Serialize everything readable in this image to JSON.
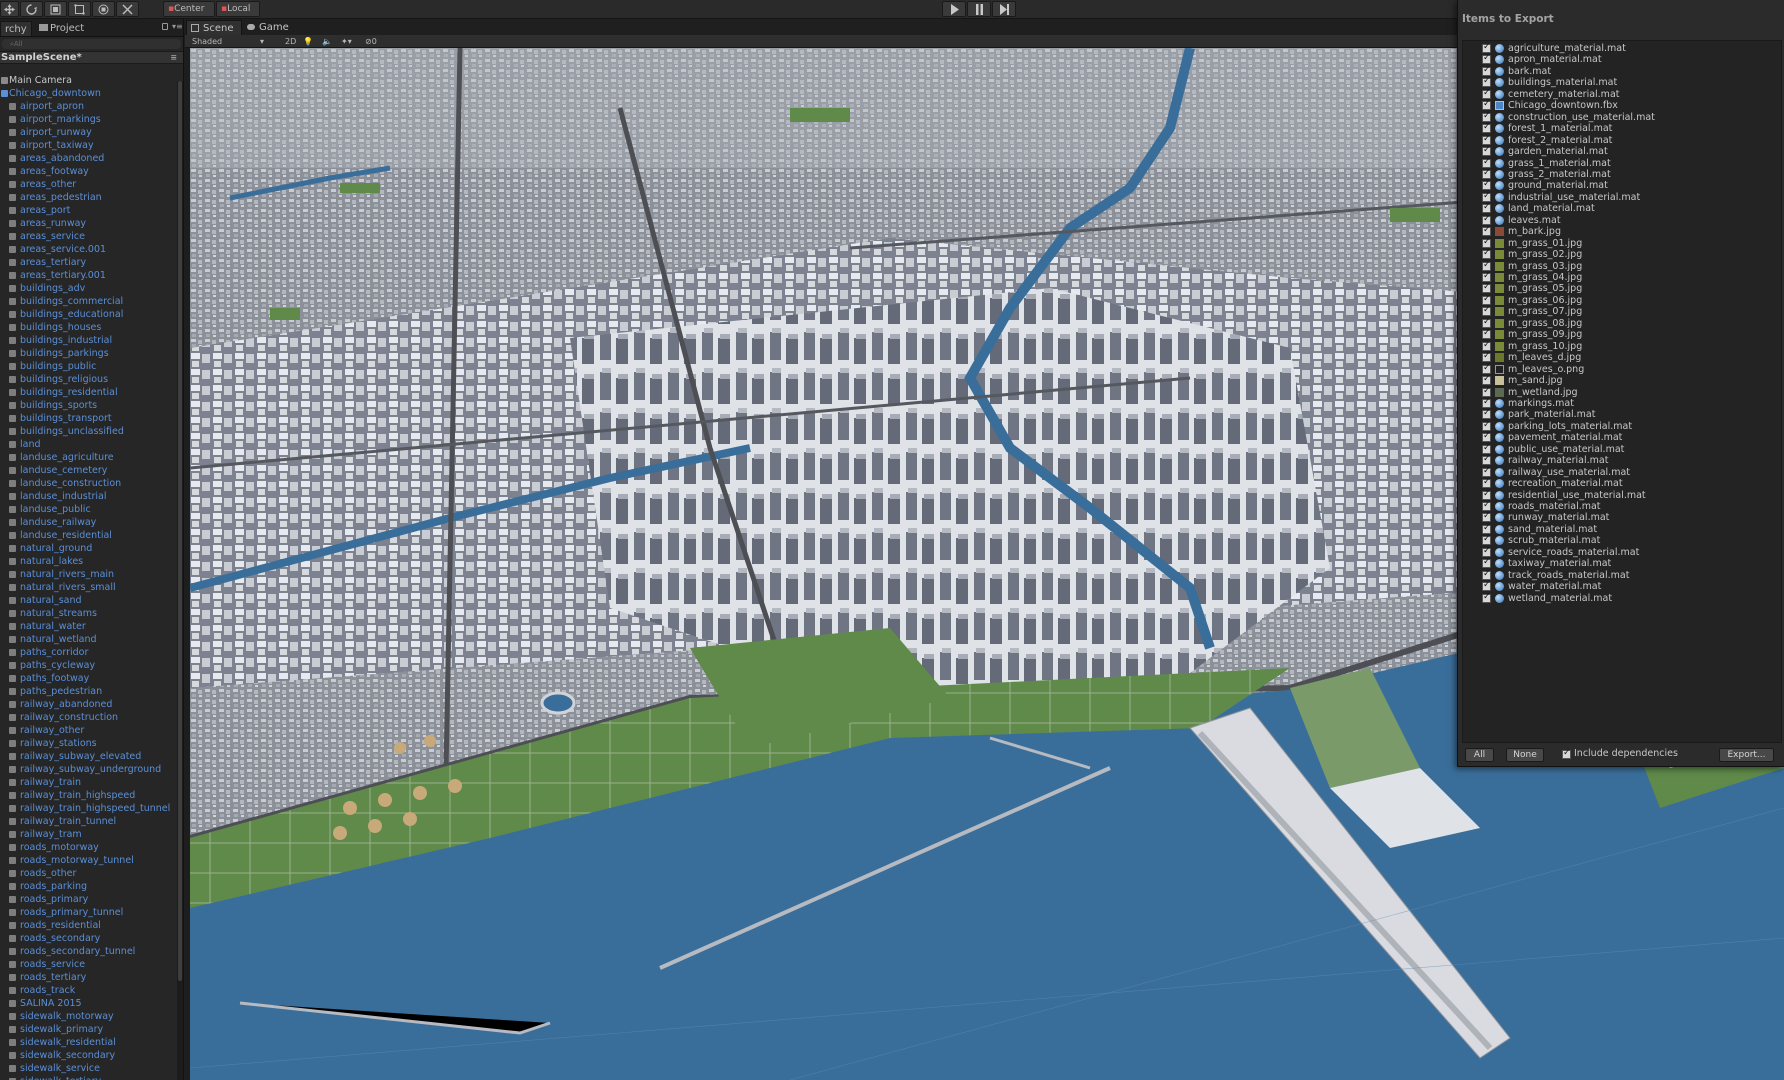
{
  "toolbar": {
    "pivot_label": "Center",
    "space_label": "Local"
  },
  "hierarchy": {
    "tab_label": "rchy",
    "project_tab_label": "Project",
    "search_placeholder": "All",
    "scene_name": "SampleScene*",
    "camera_label": "Main Camera",
    "root_label": "Chicago_downtown",
    "items": [
      "airport_apron",
      "airport_markings",
      "airport_runway",
      "airport_taxiway",
      "areas_abandoned",
      "areas_footway",
      "areas_other",
      "areas_pedestrian",
      "areas_port",
      "areas_runway",
      "areas_service",
      "areas_service.001",
      "areas_tertiary",
      "areas_tertiary.001",
      "buildings_adv",
      "buildings_commercial",
      "buildings_educational",
      "buildings_houses",
      "buildings_industrial",
      "buildings_parkings",
      "buildings_public",
      "buildings_religious",
      "buildings_residential",
      "buildings_sports",
      "buildings_transport",
      "buildings_unclassified",
      "land",
      "landuse_agriculture",
      "landuse_cemetery",
      "landuse_construction",
      "landuse_industrial",
      "landuse_public",
      "landuse_railway",
      "landuse_residential",
      "natural_ground",
      "natural_lakes",
      "natural_rivers_main",
      "natural_rivers_small",
      "natural_sand",
      "natural_streams",
      "natural_water",
      "natural_wetland",
      "paths_corridor",
      "paths_cycleway",
      "paths_footway",
      "paths_pedestrian",
      "railway_abandoned",
      "railway_construction",
      "railway_other",
      "railway_stations",
      "railway_subway_elevated",
      "railway_subway_underground",
      "railway_train",
      "railway_train_highspeed",
      "railway_train_highspeed_tunnel",
      "railway_train_tunnel",
      "railway_tram",
      "roads_motorway",
      "roads_motorway_tunnel",
      "roads_other",
      "roads_parking",
      "roads_primary",
      "roads_primary_tunnel",
      "roads_residential",
      "roads_secondary",
      "roads_secondary_tunnel",
      "roads_service",
      "roads_tertiary",
      "roads_track",
      "SALINA 2015",
      "sidewalk_motorway",
      "sidewalk_primary",
      "sidewalk_residential",
      "sidewalk_secondary",
      "sidewalk_service",
      "sidewalk_tertiary"
    ]
  },
  "scene_view": {
    "scene_tab": "Scene",
    "game_tab": "Game",
    "shading_mode": "Shaded",
    "mode_2d": "2D",
    "gizmo_count": "0"
  },
  "export_window": {
    "title": "Items to Export",
    "items": [
      {
        "name": "agriculture_material.mat",
        "icon": "mat"
      },
      {
        "name": "apron_material.mat",
        "icon": "mat"
      },
      {
        "name": "bark.mat",
        "icon": "mat"
      },
      {
        "name": "buildings_material.mat",
        "icon": "mat"
      },
      {
        "name": "cemetery_material.mat",
        "icon": "mat"
      },
      {
        "name": "Chicago_downtown.fbx",
        "icon": "fbx"
      },
      {
        "name": "construction_use_material.mat",
        "icon": "mat"
      },
      {
        "name": "forest_1_material.mat",
        "icon": "mat"
      },
      {
        "name": "forest_2_material.mat",
        "icon": "mat"
      },
      {
        "name": "garden_material.mat",
        "icon": "mat"
      },
      {
        "name": "grass_1_material.mat",
        "icon": "mat"
      },
      {
        "name": "grass_2_material.mat",
        "icon": "mat"
      },
      {
        "name": "ground_material.mat",
        "icon": "mat"
      },
      {
        "name": "industrial_use_material.mat",
        "icon": "mat"
      },
      {
        "name": "land_material.mat",
        "icon": "mat"
      },
      {
        "name": "leaves.mat",
        "icon": "mat"
      },
      {
        "name": "m_bark.jpg",
        "icon": "bark"
      },
      {
        "name": "m_grass_01.jpg",
        "icon": "tex"
      },
      {
        "name": "m_grass_02.jpg",
        "icon": "tex"
      },
      {
        "name": "m_grass_03.jpg",
        "icon": "tex"
      },
      {
        "name": "m_grass_04.jpg",
        "icon": "tex"
      },
      {
        "name": "m_grass_05.jpg",
        "icon": "tex"
      },
      {
        "name": "m_grass_06.jpg",
        "icon": "tex"
      },
      {
        "name": "m_grass_07.jpg",
        "icon": "tex"
      },
      {
        "name": "m_grass_08.jpg",
        "icon": "tex"
      },
      {
        "name": "m_grass_09.jpg",
        "icon": "tex"
      },
      {
        "name": "m_grass_10.jpg",
        "icon": "tex"
      },
      {
        "name": "m_leaves_d.jpg",
        "icon": "leaves"
      },
      {
        "name": "m_leaves_o.png",
        "icon": "leaveso"
      },
      {
        "name": "m_sand.jpg",
        "icon": "sand"
      },
      {
        "name": "m_wetland.jpg",
        "icon": "wet"
      },
      {
        "name": "markings.mat",
        "icon": "mat"
      },
      {
        "name": "park_material.mat",
        "icon": "mat"
      },
      {
        "name": "parking_lots_material.mat",
        "icon": "mat"
      },
      {
        "name": "pavement_material.mat",
        "icon": "mat"
      },
      {
        "name": "public_use_material.mat",
        "icon": "mat"
      },
      {
        "name": "railway_material.mat",
        "icon": "mat"
      },
      {
        "name": "railway_use_material.mat",
        "icon": "mat"
      },
      {
        "name": "recreation_material.mat",
        "icon": "mat"
      },
      {
        "name": "residential_use_material.mat",
        "icon": "mat"
      },
      {
        "name": "roads_material.mat",
        "icon": "mat"
      },
      {
        "name": "runway_material.mat",
        "icon": "mat"
      },
      {
        "name": "sand_material.mat",
        "icon": "mat"
      },
      {
        "name": "scrub_material.mat",
        "icon": "mat"
      },
      {
        "name": "service_roads_material.mat",
        "icon": "mat"
      },
      {
        "name": "taxiway_material.mat",
        "icon": "mat"
      },
      {
        "name": "track_roads_material.mat",
        "icon": "mat"
      },
      {
        "name": "water_material.mat",
        "icon": "mat"
      },
      {
        "name": "wetland_material.mat",
        "icon": "mat"
      }
    ],
    "all_button": "All",
    "none_button": "None",
    "include_dependencies_label": "Include dependencies",
    "include_dependencies_checked": true,
    "export_button": "Export..."
  },
  "colors": {
    "water": "#3a6e9a",
    "park": "#5f8a4a",
    "building_light": "#e6e9ee",
    "building_dark": "#7d8490",
    "hierarchy_link": "#5b8fd6"
  }
}
